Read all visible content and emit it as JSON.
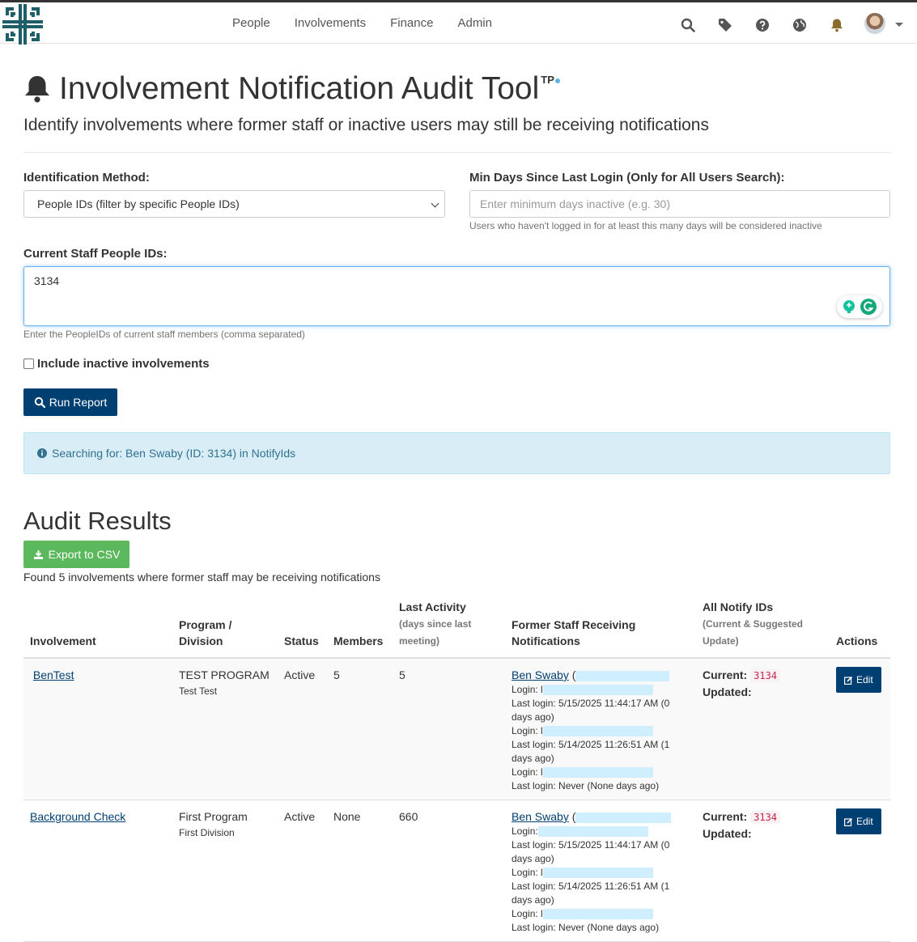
{
  "nav": {
    "items": [
      "People",
      "Involvements",
      "Finance",
      "Admin"
    ],
    "icons": [
      "search-icon",
      "tag-icon",
      "question-icon",
      "globe-icon",
      "bell-icon"
    ]
  },
  "page": {
    "title": "Involvement Notification Audit Tool",
    "title_sup": "TP",
    "subtitle": "Identify involvements where former staff or inactive users may still be receiving notifications"
  },
  "form": {
    "method_label": "Identification Method:",
    "method_value": "People IDs (filter by specific People IDs)",
    "min_days_label": "Min Days Since Last Login (Only for All Users Search):",
    "min_days_placeholder": "Enter minimum days inactive (e.g. 30)",
    "min_days_help": "Users who haven't logged in for at least this many days will be considered inactive",
    "staff_ids_label": "Current Staff People IDs:",
    "staff_ids_value": "3134",
    "staff_ids_help": "Enter the PeopleIDs of current staff members (comma separated)",
    "include_inactive_label": "Include inactive involvements",
    "run_label": "Run Report"
  },
  "alert": {
    "text": "Searching for: Ben Swaby (ID: 3134) in NotifyIds"
  },
  "results": {
    "heading": "Audit Results",
    "export_label": "Export to CSV",
    "found_text": "Found 5 involvements where former staff may be receiving notifications",
    "headers": {
      "involvement": "Involvement",
      "program_1": "Program /",
      "program_2": "Division",
      "status": "Status",
      "members": "Members",
      "last_activity": "Last Activity",
      "last_activity_sub_1": "(days since last",
      "last_activity_sub_2": "meeting)",
      "former_staff_1": "Former Staff Receiving",
      "former_staff_2": "Notifications",
      "notify_ids": "All Notify IDs",
      "notify_ids_sub_1": "(Current & Suggested",
      "notify_ids_sub_2": "Update)",
      "actions": "Actions"
    },
    "current_label": "Current:",
    "updated_label": "Updated:",
    "edit_label": "Edit",
    "rows": [
      {
        "involvement": "BenTest",
        "program": "TEST PROGRAM",
        "division": "Test Test",
        "status": "Active",
        "members": "5",
        "last_activity": "5",
        "staff_name": "Ben Swaby",
        "staff_open": "(",
        "login_label": "Login:",
        "login_prefix": "l",
        "last_login_1": "Last login: 5/15/2025 11:44:17 AM (0",
        "last_login_1b": "days ago)",
        "last_login_2": "Last login: 5/14/2025 11:26:51 AM (1",
        "last_login_2b": "days ago)",
        "last_login_3": "Last login: Never (None days ago)",
        "current_ids": "3134"
      },
      {
        "involvement": "Background Check",
        "program": "First Program",
        "division": "First Division",
        "status": "Active",
        "members": "None",
        "last_activity": "660",
        "staff_name": "Ben Swaby",
        "staff_open": "(",
        "login_label": "Login:",
        "login_prefix": "l",
        "last_login_1": "Last login: 5/15/2025 11:44:17 AM (0",
        "last_login_1b": "days ago)",
        "last_login_2": "Last login: 5/14/2025 11:26:51 AM (1",
        "last_login_2b": "days ago)",
        "last_login_3": "Last login: Never (None days ago)",
        "current_ids": "3134"
      }
    ]
  },
  "colors": {
    "primary": "#003f72",
    "success": "#5cb85c",
    "info_bg": "#d9edf7",
    "info_text": "#31708f",
    "logo": "#1d5e69"
  }
}
